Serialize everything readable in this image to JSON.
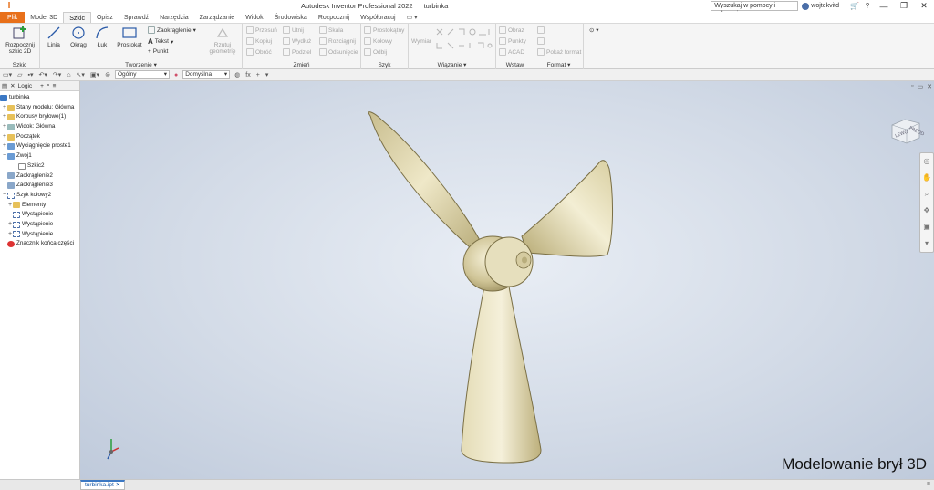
{
  "titlebar": {
    "app_title": "Autodesk Inventor Professional 2022",
    "document_name": "turbinka",
    "search_placeholder": "Wyszukaj w pomocy i polecenia",
    "user": "wojtekvitd"
  },
  "menu": {
    "tabs": [
      "Plik",
      "Model 3D",
      "Szkic",
      "Opisz",
      "Sprawdź",
      "Narzędzia",
      "Zarządzanie",
      "Widok",
      "Środowiska",
      "Rozpocznij",
      "Współpracuj"
    ],
    "active": "Szkic"
  },
  "ribbon": {
    "szkic_group": {
      "label": "Szkic",
      "start_sketch": "Rozpocznij szkic 2D"
    },
    "tworzenie_group": {
      "label": "Tworzenie ▾",
      "linia": "Linia",
      "okrag": "Okrąg",
      "luk": "Łuk",
      "prostokat": "Prostokąt",
      "zaokraglenie": "Zaokrąglenie",
      "tekst": "Tekst",
      "punkt": "Punkt",
      "rzutuj": "Rzutuj geometrię"
    },
    "zmien_group": {
      "label": "Zmień",
      "przesun": "Przesuń",
      "kopiuj": "Kopiuj",
      "obroc": "Obróć",
      "utnij": "Utnij",
      "wydluz": "Wydłuż",
      "podziel": "Podziel",
      "skala": "Skala",
      "rozciagnij": "Rozciągnij",
      "odsuniecie": "Odsunięcie"
    },
    "szyk_group": {
      "label": "Szyk",
      "prostokatny": "Prostokątny",
      "kolowy": "Kołowy",
      "odbij": "Odbij"
    },
    "wiazanie_group": {
      "label": "Wiązanie ▾",
      "wymiar": "Wymiar"
    },
    "wstaw_group": {
      "label": "Wstaw",
      "obraz": "Obraz",
      "punkty": "Punkty",
      "acad": "ACAD"
    },
    "format_group": {
      "label": "Format ▾",
      "pokaz_format": "Pokaż format"
    }
  },
  "qat": {
    "style_select": "Ogólny",
    "appearance_select": "Domyślna",
    "fx": "fx"
  },
  "browser": {
    "tabs": [
      "Logic"
    ],
    "root": "turbinka",
    "items": [
      {
        "label": "Stany modelu: Główna",
        "level": 1,
        "exp": "+"
      },
      {
        "label": "Korpusy bryłowe(1)",
        "level": 1,
        "exp": "+"
      },
      {
        "label": "Widok: Główna",
        "level": 1,
        "exp": "+"
      },
      {
        "label": "Początek",
        "level": 1,
        "exp": "+"
      },
      {
        "label": "Wyciągnięcie proste1",
        "level": 1,
        "exp": "+"
      },
      {
        "label": "Zwój1",
        "level": 1,
        "exp": "−"
      },
      {
        "label": "Szkic2",
        "level": 2,
        "exp": ""
      },
      {
        "label": "Zaokrąglenie2",
        "level": 1,
        "exp": ""
      },
      {
        "label": "Zaokrąglenie3",
        "level": 1,
        "exp": ""
      },
      {
        "label": "Szyk kołowy2",
        "level": 1,
        "exp": "−"
      },
      {
        "label": "Elementy",
        "level": 2,
        "exp": "+"
      },
      {
        "label": "Wystąpienie",
        "level": 2,
        "exp": ""
      },
      {
        "label": "Wystąpienie",
        "level": 2,
        "exp": "+"
      },
      {
        "label": "Wystąpienie",
        "level": 2,
        "exp": "+"
      },
      {
        "label": "Znacznik końca części",
        "level": 1,
        "exp": ""
      }
    ]
  },
  "viewport": {
    "watermark": "Modelowanie brył 3D",
    "viewcube_left": "LEWO",
    "viewcube_front": "PRZÓD"
  },
  "status": {
    "doc_tab": "turbinka.ipt"
  },
  "colors": {
    "accent": "#e8701a",
    "model": "#d7cfa8",
    "model_edge": "#7a6f45"
  }
}
